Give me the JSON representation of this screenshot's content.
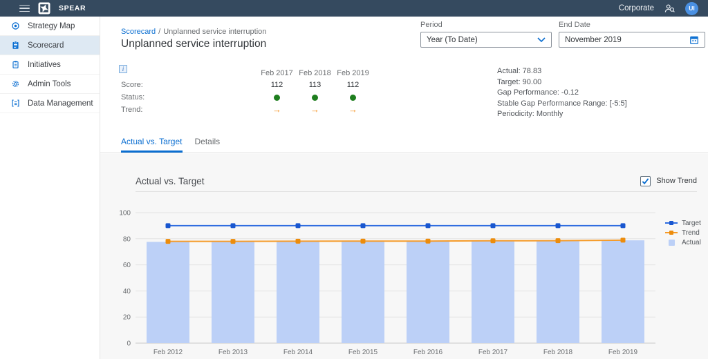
{
  "navbar": {
    "app_name": "SPEAR",
    "context_label": "Corporate",
    "avatar_initials": "UI"
  },
  "sidebar": {
    "items": [
      {
        "label": "Strategy Map",
        "icon": "strategy-map-icon",
        "active": false
      },
      {
        "label": "Scorecard",
        "icon": "scorecard-icon",
        "active": true
      },
      {
        "label": "Initiatives",
        "icon": "initiatives-icon",
        "active": false
      },
      {
        "label": "Admin Tools",
        "icon": "admin-tools-icon",
        "active": false
      },
      {
        "label": "Data Management",
        "icon": "data-management-icon",
        "active": false
      }
    ]
  },
  "header": {
    "breadcrumb": {
      "parent": "Scorecard",
      "separator": "/",
      "current": "Unplanned service interruption"
    },
    "title": "Unplanned service interruption",
    "period": {
      "label": "Period",
      "value": "Year (To Date)"
    },
    "end_date": {
      "label": "End Date",
      "value": "November 2019"
    }
  },
  "kpi": {
    "info_icon_glyph": "i",
    "columns": [
      "Feb 2017",
      "Feb 2018",
      "Feb 2019"
    ],
    "rows": {
      "score": {
        "label": "Score:",
        "values": [
          "112",
          "113",
          "112"
        ]
      },
      "status": {
        "label": "Status:",
        "status_color": "#1e7e1e"
      },
      "trend": {
        "label": "Trend:",
        "arrow": "→",
        "trend_color": "#f59323"
      }
    },
    "details": [
      "Actual: 78.83",
      "Target: 90.00",
      "Gap Performance: -0.12",
      "Stable Gap Performance Range: [-5:5]",
      "Periodicity: Monthly"
    ]
  },
  "tabs": [
    {
      "label": "Actual vs. Target",
      "active": true
    },
    {
      "label": "Details",
      "active": false
    }
  ],
  "chart_section": {
    "title": "Actual vs. Target",
    "show_trend_label": "Show Trend",
    "show_trend_checked": true
  },
  "chart_data": {
    "type": "bar",
    "title": "Actual vs. Target",
    "categories": [
      "Feb 2012",
      "Feb 2013",
      "Feb 2014",
      "Feb 2015",
      "Feb 2016",
      "Feb 2017",
      "Feb 2018",
      "Feb 2019"
    ],
    "series": [
      {
        "name": "Target",
        "type": "line",
        "color": "#2e6ce0",
        "marker_color": "#1856cf",
        "values": [
          90,
          90,
          90,
          90,
          90,
          90,
          90,
          90
        ]
      },
      {
        "name": "Trend",
        "type": "line",
        "color": "#f59b2a",
        "marker_color": "#ec8c0c",
        "values": [
          78,
          78,
          78.1,
          78.2,
          78.2,
          78.4,
          78.5,
          78.9
        ]
      },
      {
        "name": "Actual",
        "type": "bar",
        "color": "#bcd0f7",
        "values": [
          77.6,
          77.7,
          77.9,
          78.1,
          77.9,
          78.4,
          78.2,
          78.8
        ]
      }
    ],
    "ylim": [
      0,
      100
    ],
    "yticks": [
      0,
      20,
      40,
      60,
      80,
      100
    ],
    "grid": true,
    "legend_position": "right"
  }
}
